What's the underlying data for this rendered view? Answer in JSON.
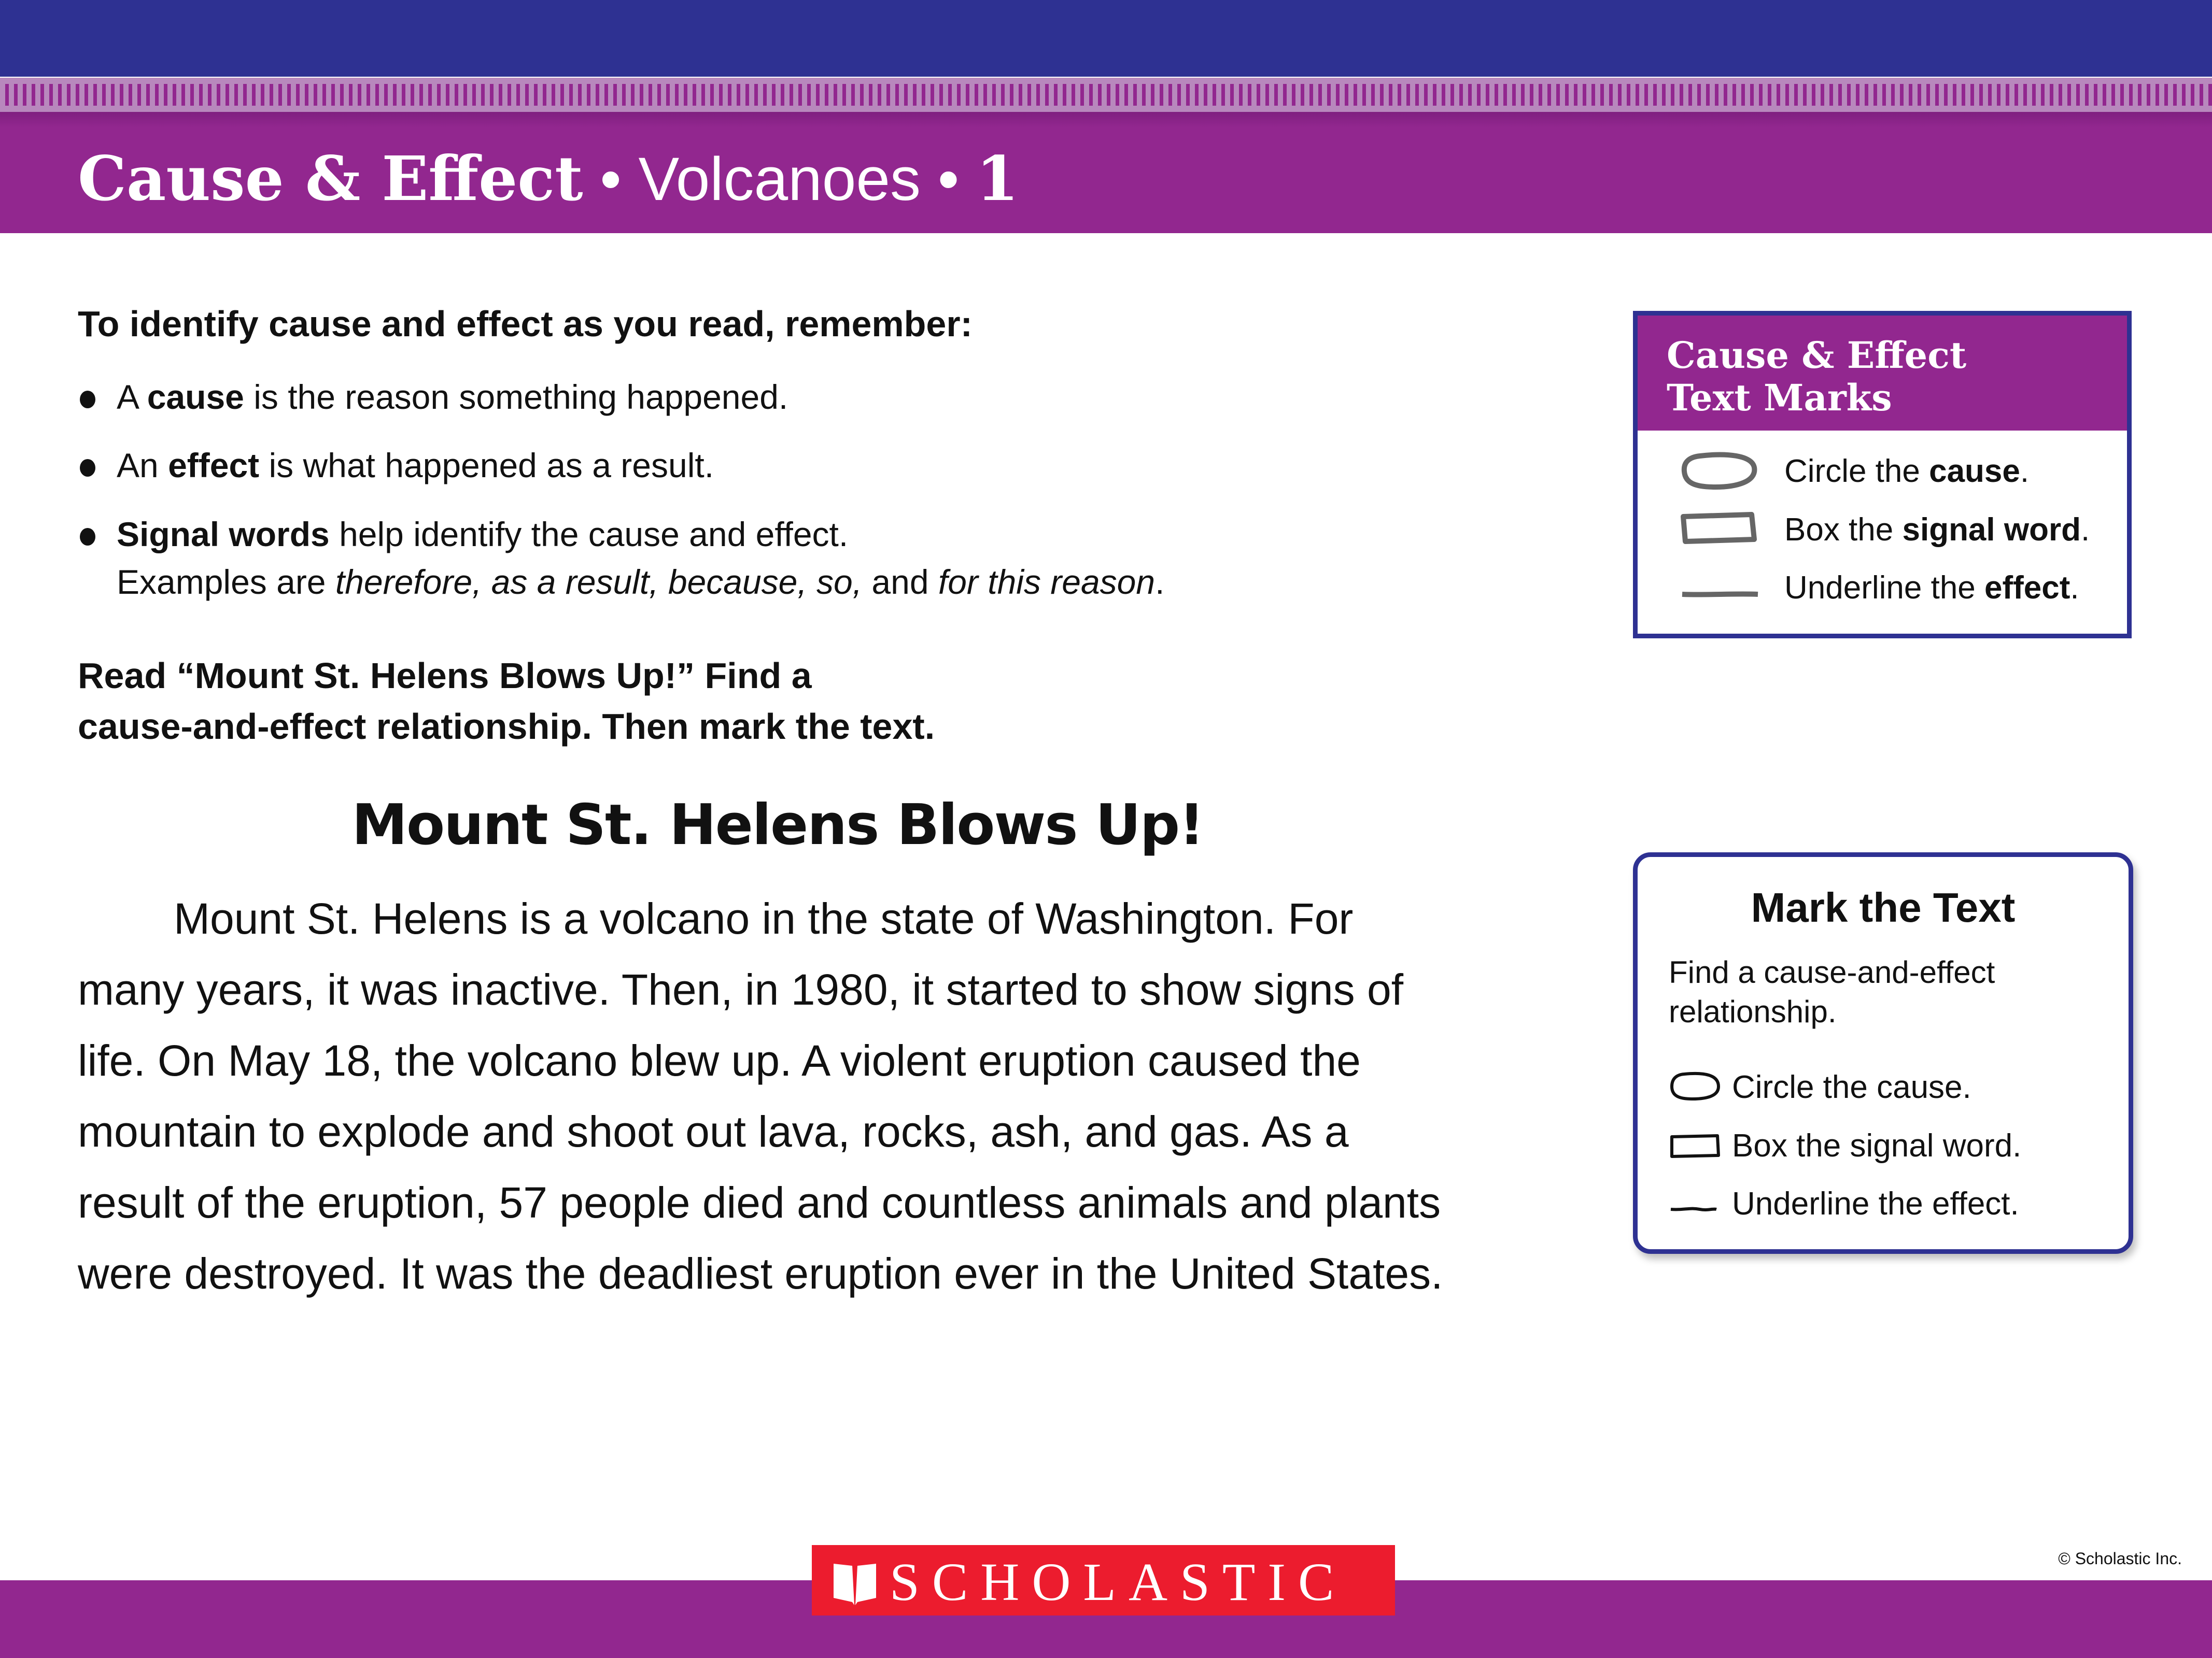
{
  "header": {
    "title_strong": "Cause & Effect",
    "separator": " • ",
    "topic": "Volcanoes",
    "number": "1"
  },
  "intro": {
    "heading": "To identify cause and effect as you read, remember:",
    "bullets": [
      {
        "pre": "A ",
        "bold": "cause",
        "post": " is the reason something happened."
      },
      {
        "pre": "An ",
        "bold": "effect",
        "post": " is what happened as a result."
      },
      {
        "pre": "",
        "bold": "Signal words",
        "post": " help identify the cause and effect.",
        "examples_pre": "Examples are ",
        "examples": [
          {
            "text": "therefore, as a result, because, so,",
            "italic": true
          },
          {
            "text": " and ",
            "italic": false
          },
          {
            "text": "for this reason",
            "italic": true
          },
          {
            "text": ".",
            "italic": false
          }
        ]
      }
    ]
  },
  "instruction": {
    "line1": "Read “Mount St. Helens Blows Up!” Find a",
    "line2": "cause-and-effect relationship. Then mark the text."
  },
  "story": {
    "title": "Mount St. Helens Blows Up!",
    "body": "Mount St. Helens is a volcano in the state of Washington. For many years, it was inactive. Then, in 1980, it started to show signs of life. On May 18, the volcano blew up. A violent eruption caused the mountain to explode and shoot out lava, rocks, ash, and gas. As a result of the eruption, 57 people died and countless animals and plants were destroyed. It was the deadliest eruption ever in the United States."
  },
  "text_marks": {
    "title_line1": "Cause & Effect",
    "title_line2": "Text Marks",
    "items": [
      {
        "icon": "circle-mark-icon",
        "pre": "Circle the ",
        "bold": "cause",
        "post": "."
      },
      {
        "icon": "box-mark-icon",
        "pre": "Box the ",
        "bold": "signal word",
        "post": "."
      },
      {
        "icon": "underline-mark-icon",
        "pre": "Underline the ",
        "bold": "effect",
        "post": "."
      }
    ]
  },
  "mark_the_text": {
    "title": "Mark the Text",
    "description": "Find a cause-and-effect relationship.",
    "items": [
      {
        "icon": "circle-mark-icon",
        "label": "Circle the cause."
      },
      {
        "icon": "box-mark-icon",
        "label": "Box the signal word."
      },
      {
        "icon": "underline-mark-icon",
        "label": "Underline the effect."
      }
    ]
  },
  "footer": {
    "logo_text": "SCHOLASTIC",
    "copyright": "© Scholastic Inc."
  },
  "colors": {
    "navy": "#2e3192",
    "purple": "#92278f",
    "ruler": "#b888bd",
    "logo_red": "#ec1c2e",
    "mark_gray": "#666666"
  }
}
